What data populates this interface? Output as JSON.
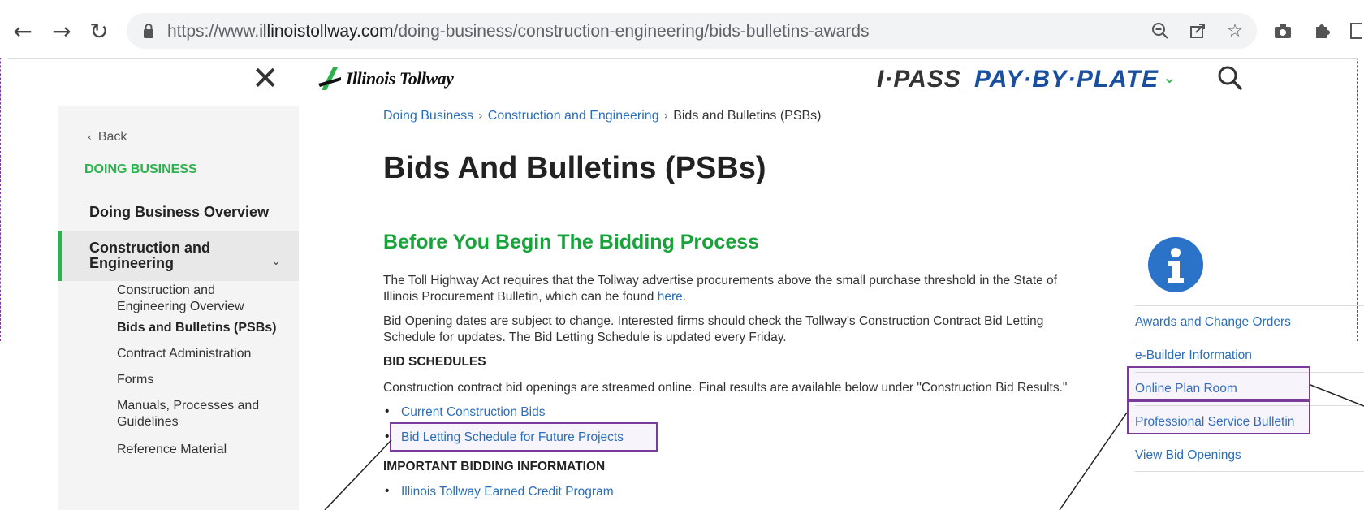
{
  "browser": {
    "url_prefix": "https://www.",
    "url_domain": "illinoistollway.com",
    "url_path": "/doing-business/construction-engineering/bids-bulletins-awards"
  },
  "header": {
    "logo_text": "Illinois Tollway",
    "ipass": "I·PASS",
    "pay_by_plate": "PAY·BY·PLATE"
  },
  "sidebar": {
    "back": "Back",
    "section_title": "DOING BUSINESS",
    "items": [
      {
        "label": "Doing Business Overview"
      },
      {
        "label_line1": "Construction and",
        "label_line2": "Engineering"
      }
    ],
    "sub_items": [
      {
        "line1": "Construction and",
        "line2": "Engineering Overview"
      },
      {
        "line1": "Bids and Bulletins (PSBs)"
      },
      {
        "line1": "Contract Administration"
      },
      {
        "line1": "Forms"
      },
      {
        "line1": "Manuals, Processes and",
        "line2": "Guidelines"
      },
      {
        "line1": "Reference Material"
      }
    ]
  },
  "breadcrumb": {
    "items": [
      "Doing Business",
      "Construction and Engineering"
    ],
    "current": "Bids and Bulletins (PSBs)"
  },
  "main": {
    "title": "Bids And Bulletins (PSBs)",
    "heading": "Before You Begin The Bidding Process",
    "para1_line1": "The Toll Highway Act requires that the Tollway advertise procurements above the small purchase threshold in the State of",
    "para1_line2_text": "Illinois Procurement Bulletin, which can be found ",
    "para1_link": "here",
    "para2_line1": "Bid Opening dates are subject to change. Interested firms should check the Tollway's Construction Contract Bid Letting",
    "para2_line2": "Schedule for updates. The Bid Letting Schedule is updated every Friday.",
    "bid_schedules_heading": "BID SCHEDULES",
    "bid_schedules_text": "Construction contract bid openings are streamed online. Final results are available below under \"Construction Bid Results.\"",
    "bid_links": [
      "Current Construction Bids",
      "Bid Letting Schedule for Future Projects"
    ],
    "important_heading": "IMPORTANT BIDDING INFORMATION",
    "important_links": [
      "Illinois Tollway Earned Credit Program"
    ]
  },
  "info_panel": {
    "links": [
      "Awards and Change Orders",
      "e-Builder Information",
      "Online Plan Room",
      "Professional Service Bulletin",
      "View Bid Openings"
    ]
  },
  "colors": {
    "accent_green": "#17a33a",
    "link_blue": "#2a6ebb",
    "brand_blue": "#1a4fa0",
    "highlight_purple": "#7a3b9c"
  }
}
